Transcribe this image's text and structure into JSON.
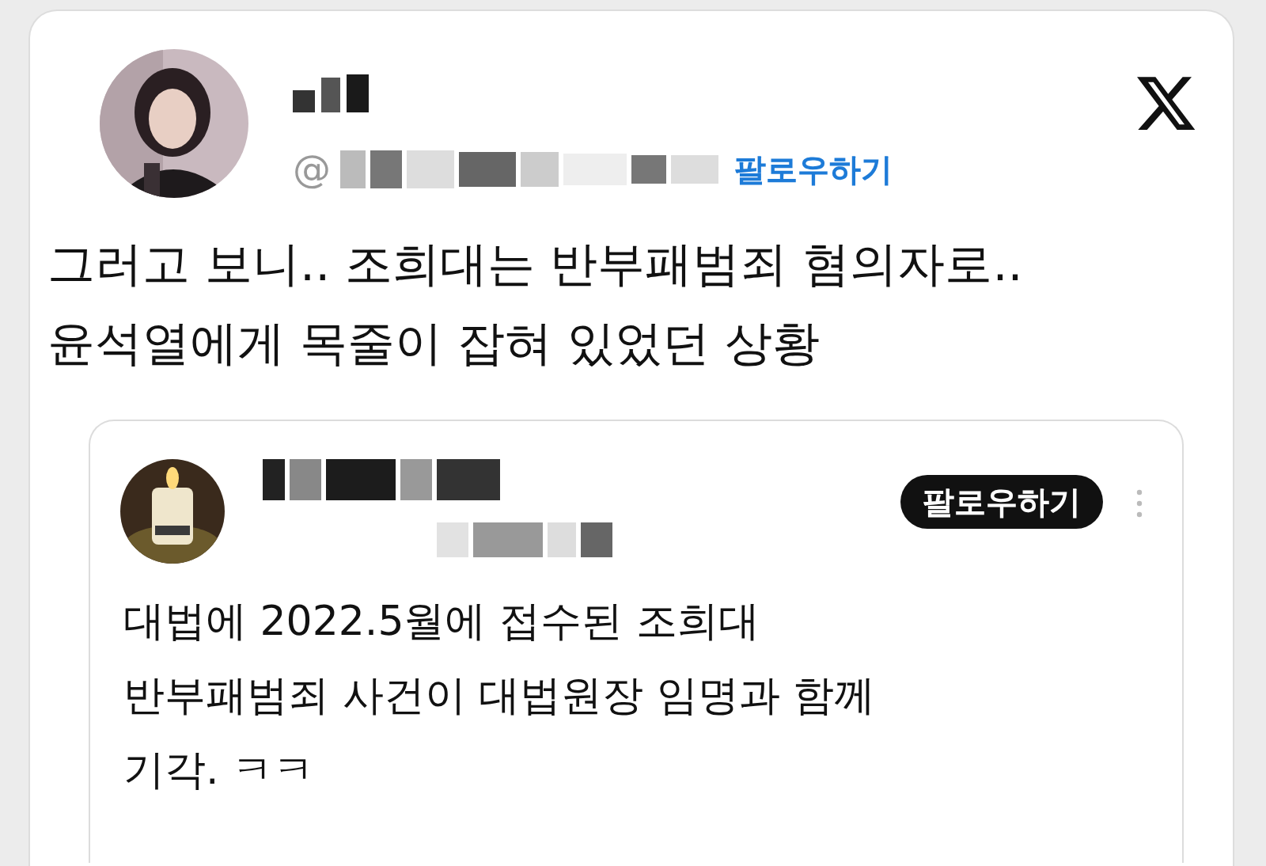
{
  "post": {
    "handle_prefix": "@",
    "follow_link": "팔로우하기",
    "text": "그러고 보니.. 조희대는 반부패범죄 혐의자로.. 윤석열에게 목줄이 잡혀 있었던 상황",
    "quote": {
      "follow_button": "팔로우하기",
      "text": "대법에 2022.5월에 접수된 조희대\n반부패범죄 사건이 대법원장 임명과 함께\n기각. ㅋㅋ"
    }
  }
}
